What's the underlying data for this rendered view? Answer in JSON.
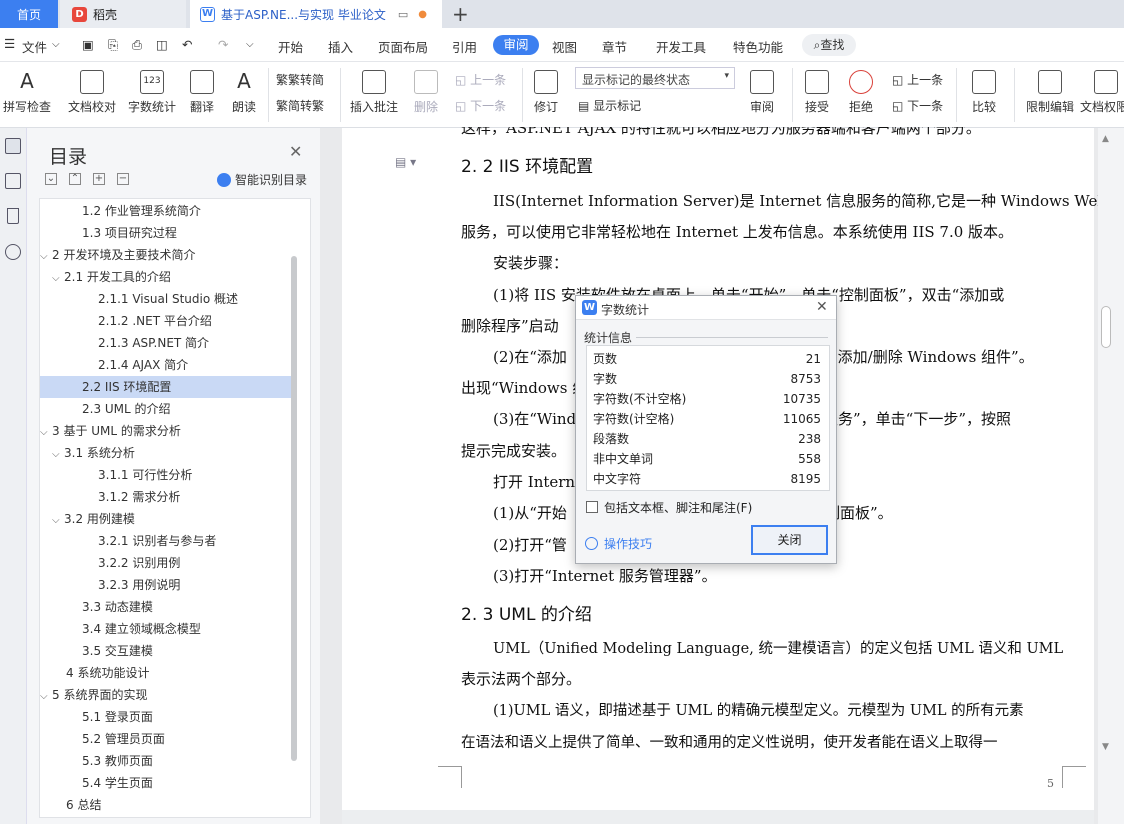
{
  "titlebar": {
    "home_tab": "首页",
    "wps_tab": "稻壳",
    "doc_tab": "基于ASP.NE...与实现 毕业论文",
    "new_tab": "+"
  },
  "menu": {
    "file": "文件",
    "items": [
      "开始",
      "插入",
      "页面布局",
      "引用",
      "审阅",
      "视图",
      "章节",
      "开发工具",
      "特色功能"
    ],
    "active": "审阅",
    "search": "查找"
  },
  "ribbon": {
    "spellcheck": "拼写检查",
    "proofread": "文档校对",
    "wordcount": "字数统计",
    "translate": "翻译",
    "readaloud": "朗读",
    "to_traditional": "繁转简",
    "to_simplified": "简转繁",
    "insert_comment": "插入批注",
    "delete": "删除",
    "prev": "上一条",
    "next": "下一条",
    "revise": "修订",
    "view_state": "显示标记的最终状态",
    "show_markup": "显示标记",
    "review": "审阅",
    "accept": "接受",
    "reject": "拒绝",
    "prev2": "上一条",
    "next2": "下一条",
    "compare": "比较",
    "restrict": "限制编辑",
    "doc_rights": "文档权限"
  },
  "toc": {
    "title": "目录",
    "smart": "智能识别目录",
    "items": [
      {
        "label": "1.2  作业管理系统简介",
        "arrow": ""
      },
      {
        "label": "1.3  项目研究过程",
        "arrow": ""
      },
      {
        "label": "2  开发环境及主要技术简介",
        "arrow": "⌵"
      },
      {
        "label": "2.1  开发工具的介绍",
        "arrow": "⌵"
      },
      {
        "label": "2.1.1 Visual Studio 概述",
        "arrow": ""
      },
      {
        "label": "2.1.2 .NET 平台介绍",
        "arrow": ""
      },
      {
        "label": "2.1.3 ASP.NET 简介",
        "arrow": ""
      },
      {
        "label": "2.1.4 AJAX 简介",
        "arrow": ""
      },
      {
        "label": "2.2 IIS 环境配置",
        "arrow": ""
      },
      {
        "label": "2.3 UML 的介绍",
        "arrow": ""
      },
      {
        "label": "3  基于 UML 的需求分析",
        "arrow": "⌵"
      },
      {
        "label": "3.1  系统分析",
        "arrow": "⌵"
      },
      {
        "label": "3.1.1  可行性分析",
        "arrow": ""
      },
      {
        "label": "3.1.2  需求分析",
        "arrow": ""
      },
      {
        "label": "3.2  用例建模",
        "arrow": "⌵"
      },
      {
        "label": "3.2.1  识别者与参与者",
        "arrow": ""
      },
      {
        "label": "3.2.2  识别用例",
        "arrow": ""
      },
      {
        "label": "3.2.3  用例说明",
        "arrow": ""
      },
      {
        "label": "3.3  动态建模",
        "arrow": ""
      },
      {
        "label": "3.4  建立领域概念模型",
        "arrow": ""
      },
      {
        "label": "3.5  交互建模",
        "arrow": ""
      },
      {
        "label": "4  系统功能设计",
        "arrow": ""
      },
      {
        "label": "5  系统界面的实现",
        "arrow": "⌵"
      },
      {
        "label": "5.1  登录页面",
        "arrow": ""
      },
      {
        "label": "5.2  管理员页面",
        "arrow": ""
      },
      {
        "label": "5.3  教师页面",
        "arrow": ""
      },
      {
        "label": "5.4  学生页面",
        "arrow": ""
      },
      {
        "label": "6  总结",
        "arrow": ""
      }
    ],
    "selected_index": 8
  },
  "doc": {
    "top_cut": "这样，ASP.NET AJAX 的特性就可以相应地分为服务器端和客户端两个部分。",
    "h_iis": "2. 2 IIS 环境配置",
    "p1a": "IIS(Internet Information Server)是 Internet 信息服务的简称,它是一种 Windows Web",
    "p1b": "服务，可以使用它非常轻松地在 Internet 上发布信息。本系统使用 IIS 7.0 版本。",
    "p2": "安装步骤：",
    "p3a": "(1)将 IIS 安装软件放在桌面上，单击“开始”，单击“控制面板”，双击“添加或",
    "p3b": "删除程序”启动",
    "p4a": "(2)在“添加",
    "p4a_r": "击“添加/删除 Windows 组件”。",
    "p4b": "出现“Windows 组",
    "p5a": "(3)在“Wind",
    "p5a_r": "服务”，单击“下一步”，按照",
    "p5b": "提示完成安装。",
    "p6": "打开 Internet",
    "p7": "(1)从“开始",
    "p7_r": "制面板”。",
    "p8": "(2)打开“管",
    "p9": "(3)打开“Internet 服务管理器”。",
    "h_uml": "2. 3 UML 的介绍",
    "p10a": "UML（Unified Modeling Language, 统一建模语言）的定义包括 UML 语义和 UML",
    "p10b": "表示法两个部分。",
    "p11a": "(1)UML 语义，即描述基于 UML 的精确元模型定义。元模型为 UML 的所有元素",
    "p11b": "在语法和语义上提供了简单、一致和通用的定义性说明，使开发者能在语义上取得一",
    "page_number": "5"
  },
  "dialog": {
    "title": "字数统计",
    "group": "统计信息",
    "stats": [
      {
        "label": "页数",
        "value": "21"
      },
      {
        "label": "字数",
        "value": "8753"
      },
      {
        "label": "字符数(不计空格)",
        "value": "10735"
      },
      {
        "label": "字符数(计空格)",
        "value": "11065"
      },
      {
        "label": "段落数",
        "value": "238"
      },
      {
        "label": "非中文单词",
        "value": "558"
      },
      {
        "label": "中文字符",
        "value": "8195"
      }
    ],
    "checkbox_label": "包括文本框、脚注和尾注(F)",
    "tips": "操作技巧",
    "close_button": "关闭"
  },
  "colors": {
    "accent": "#3c7ff0",
    "selection": "#c9d9f5"
  }
}
